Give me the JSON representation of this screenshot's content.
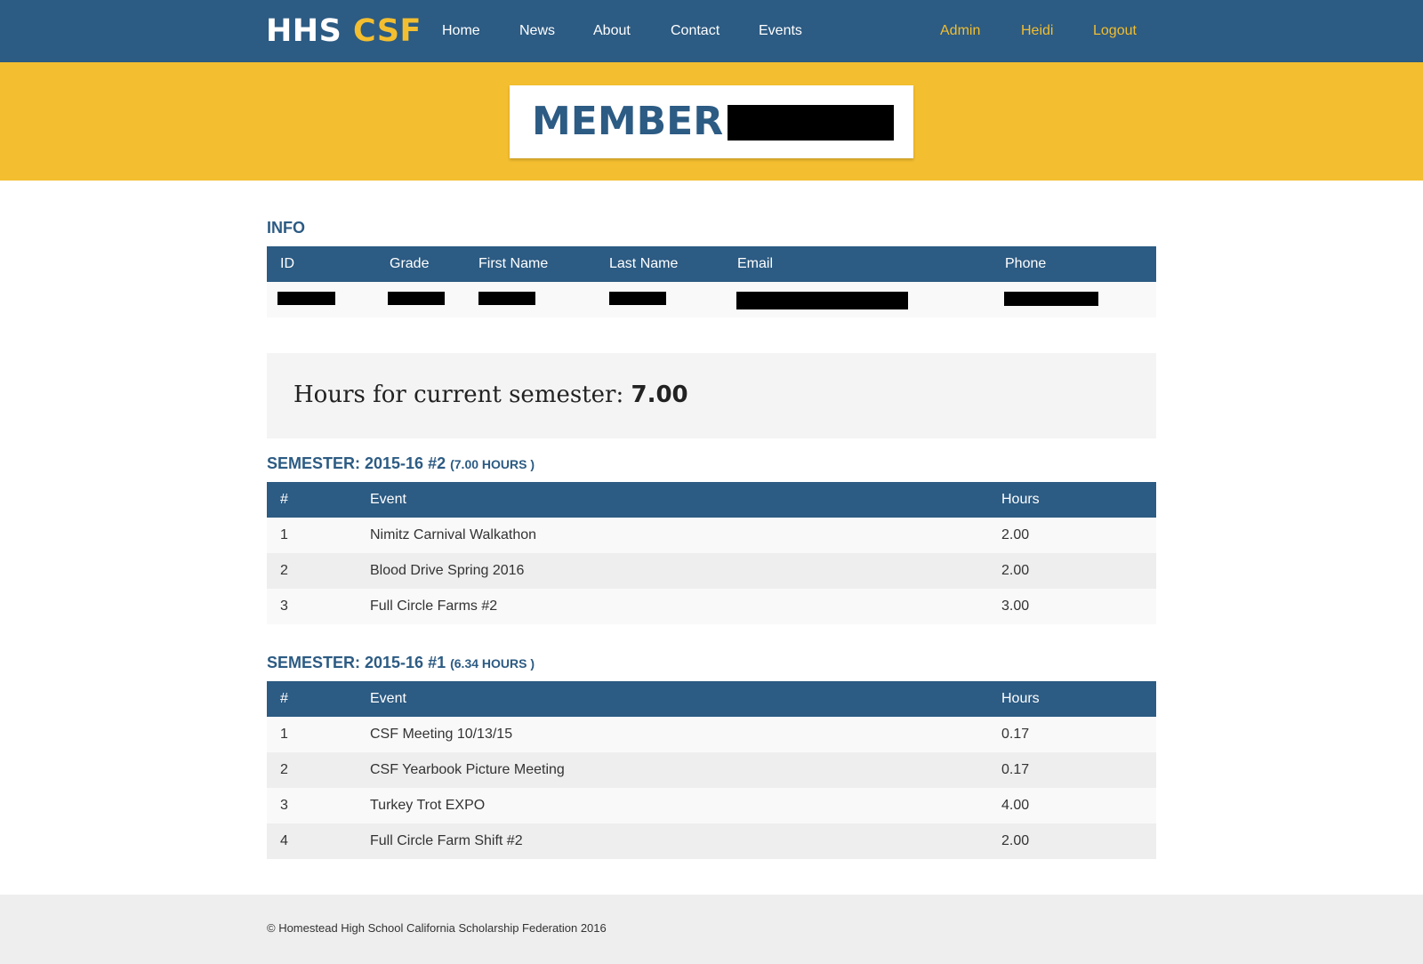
{
  "nav": {
    "brand_part1": "HHS",
    "brand_part2": "CSF",
    "links": [
      "Home",
      "News",
      "About",
      "Contact",
      "Events"
    ],
    "right_links": [
      "Admin",
      "Heidi",
      "Logout"
    ]
  },
  "banner": {
    "title": "MEMBER:"
  },
  "info": {
    "title": "INFO",
    "columns": [
      "ID",
      "Grade",
      "First Name",
      "Last Name",
      "Email",
      "Phone"
    ]
  },
  "hours": {
    "label": "Hours for current semester:",
    "value": "7.00"
  },
  "semesters": [
    {
      "title": "SEMESTER: 2015-16 #2",
      "hours_note": "(7.00 HOURS )",
      "columns": [
        "#",
        "Event",
        "Hours"
      ],
      "rows": [
        {
          "num": "1",
          "event": "Nimitz Carnival Walkathon",
          "hours": "2.00"
        },
        {
          "num": "2",
          "event": "Blood Drive Spring 2016",
          "hours": "2.00"
        },
        {
          "num": "3",
          "event": "Full Circle Farms #2",
          "hours": "3.00"
        }
      ]
    },
    {
      "title": "SEMESTER: 2015-16 #1",
      "hours_note": "(6.34 HOURS )",
      "columns": [
        "#",
        "Event",
        "Hours"
      ],
      "rows": [
        {
          "num": "1",
          "event": "CSF Meeting 10/13/15",
          "hours": "0.17"
        },
        {
          "num": "2",
          "event": "CSF Yearbook Picture Meeting",
          "hours": "0.17"
        },
        {
          "num": "3",
          "event": "Turkey Trot EXPO",
          "hours": "4.00"
        },
        {
          "num": "4",
          "event": "Full Circle Farm Shift #2",
          "hours": "2.00"
        }
      ]
    }
  ],
  "footer": {
    "text": "© Homestead High School California Scholarship Federation 2016"
  },
  "colors": {
    "primary": "#2c5b83",
    "accent": "#f3be2f"
  }
}
